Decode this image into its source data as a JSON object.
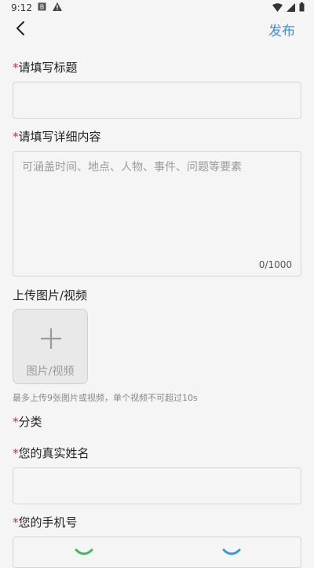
{
  "status": {
    "time": "9:12"
  },
  "nav": {
    "publish": "发布"
  },
  "form": {
    "title_label": "请填写标题",
    "detail_label": "请填写详细内容",
    "detail_placeholder": "可涵盖时间、地点、人物、事件、问题等要素",
    "detail_counter": "0/1000",
    "upload_label": "上传图片/视频",
    "upload_button": "图片/视频",
    "upload_hint": "最多上传9张图片或视频，单个视频不可超过10s",
    "category_label": "分类",
    "name_label": "您的真实姓名",
    "phone_label": "您的手机号",
    "required_mark": "*"
  }
}
